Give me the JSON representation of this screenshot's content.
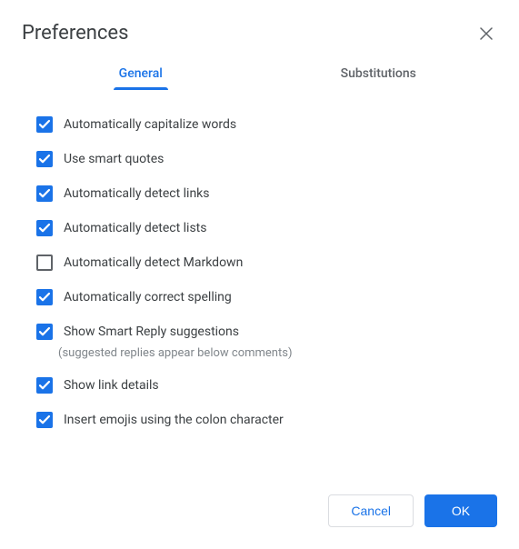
{
  "title": "Preferences",
  "tabs": {
    "general": "General",
    "substitutions": "Substitutions"
  },
  "options": [
    {
      "label": "Automatically capitalize words",
      "checked": true
    },
    {
      "label": "Use smart quotes",
      "checked": true
    },
    {
      "label": "Automatically detect links",
      "checked": true
    },
    {
      "label": "Automatically detect lists",
      "checked": true
    },
    {
      "label": "Automatically detect Markdown",
      "checked": false
    },
    {
      "label": "Automatically correct spelling",
      "checked": true
    },
    {
      "label": "Show Smart Reply suggestions",
      "checked": true,
      "sub": "(suggested replies appear below comments)"
    },
    {
      "label": "Show link details",
      "checked": true
    },
    {
      "label": "Insert emojis using the colon character",
      "checked": true
    }
  ],
  "actions": {
    "cancel": "Cancel",
    "ok": "OK"
  }
}
